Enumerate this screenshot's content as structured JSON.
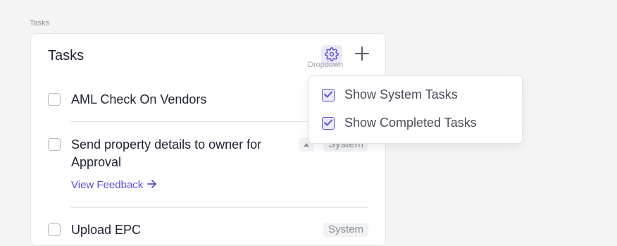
{
  "page_label": "Tasks",
  "card": {
    "title": "Tasks",
    "tooltip": "Dropdown"
  },
  "tasks": [
    {
      "title": "AML Check On Vendors",
      "badge": ""
    },
    {
      "title_line1": "Send property details to owner for",
      "title_line2": "Approval",
      "badge": "System",
      "link": "View Feedback"
    },
    {
      "title": "Upload EPC",
      "badge": "System"
    }
  ],
  "dropdown": {
    "items": [
      {
        "label": "Show System Tasks",
        "checked": true
      },
      {
        "label": "Show Completed Tasks",
        "checked": true
      }
    ]
  },
  "colors": {
    "accent": "#5b4fd6",
    "text": "#1f2233",
    "muted": "#8b8d99"
  },
  "icons": [
    "gear-icon",
    "plus-icon",
    "chevron-up-icon",
    "arrow-right-icon",
    "check-icon"
  ]
}
